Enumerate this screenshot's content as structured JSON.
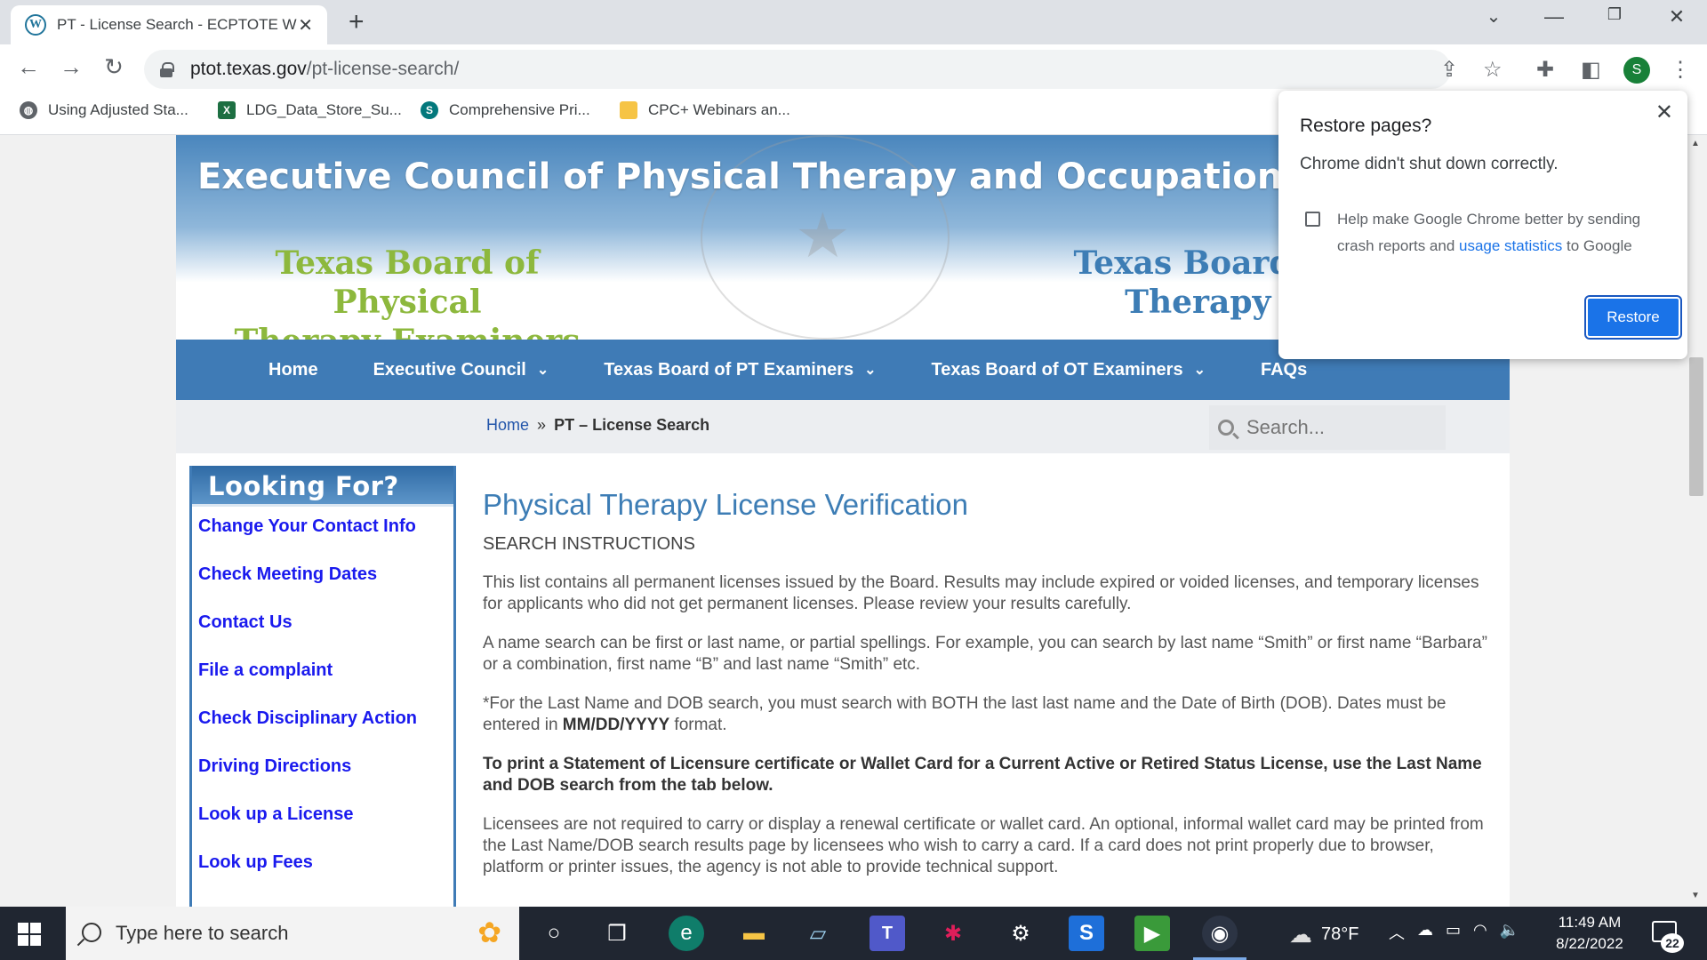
{
  "browser": {
    "tab_title": "PT - License Search - ECPTOTE W",
    "tab_close": "✕",
    "new_tab": "+",
    "url_domain": "ptot.texas.gov",
    "url_path": "/pt-license-search/",
    "profile_initial": "S",
    "bookmarks": [
      {
        "label": "Using Adjusted Sta...",
        "icon": "globe-icon"
      },
      {
        "label": "LDG_Data_Store_Su...",
        "icon": "excel-icon"
      },
      {
        "label": "Comprehensive Pri...",
        "icon": "sharepoint-icon"
      },
      {
        "label": "CPC+ Webinars an...",
        "icon": "folder-icon"
      }
    ]
  },
  "site": {
    "banner_title": "Executive Council of Physical Therapy and Occupational Therapy",
    "board_pt_line1": "Texas Board of Physical",
    "board_pt_line2": "Therapy Examiners",
    "board_ot_line1": "Texas Board of O",
    "board_ot_line2": "Therapy Ex",
    "nav": [
      {
        "label": "Home",
        "has_dropdown": false
      },
      {
        "label": "Executive Council",
        "has_dropdown": true
      },
      {
        "label": "Texas Board of PT Examiners",
        "has_dropdown": true
      },
      {
        "label": "Texas Board of OT Examiners",
        "has_dropdown": true
      },
      {
        "label": "FAQs",
        "has_dropdown": false
      }
    ],
    "breadcrumb": {
      "home": "Home",
      "sep": "»",
      "current": "PT – License Search"
    },
    "search_placeholder": "Search..."
  },
  "sidebar": {
    "heading": "Looking For?",
    "items": [
      "Change Your Contact Info",
      "Check Meeting Dates",
      "Contact Us",
      "File a complaint",
      "Check Disciplinary Action",
      "Driving Directions",
      "Look up a License",
      "Look up Fees"
    ]
  },
  "content": {
    "title": "Physical Therapy License Verification",
    "instructions_heading": "SEARCH INSTRUCTIONS",
    "para1": "This list contains all permanent licenses issued by the Board.  Results may include expired or voided licenses, and temporary licenses for applicants who did not get permanent licenses.  Please review your results carefully.",
    "para2": "A name search can be first or last name, or partial spellings.  For example, you can search by last name “Smith” or first name “Barbara” or a combination, first name “B” and last name “Smith” etc.",
    "para3_a": "*For the Last Name and DOB search, you must search with BOTH the last last name and the Date of Birth (DOB).  Dates must be entered in ",
    "para3_b": "MM/DD/YYYY",
    "para3_c": " format.",
    "para4": "To print a Statement of Licensure certificate or Wallet Card for a Current Active or Retired Status License, use the Last Name and DOB search from the tab below.",
    "para5": "Licensees are not required to carry or display a renewal certificate or wallet card. An optional, informal wallet card may be printed from the Last Name/DOB search results page by licensees who wish to carry a card.  If a card does not print properly due to browser, platform or printer issues, the agency is not able to provide technical support."
  },
  "restore_dialog": {
    "title": "Restore pages?",
    "message": "Chrome didn't shut down correctly.",
    "help_a": "Help make Google Chrome better by sending crash reports and ",
    "help_link": "usage statistics",
    "help_b": " to Google",
    "button": "Restore",
    "checked": false
  },
  "taskbar": {
    "search_placeholder": "Type here to search",
    "weather": "78°F",
    "time": "11:49 AM",
    "date": "8/22/2022",
    "notification_count": "22"
  }
}
